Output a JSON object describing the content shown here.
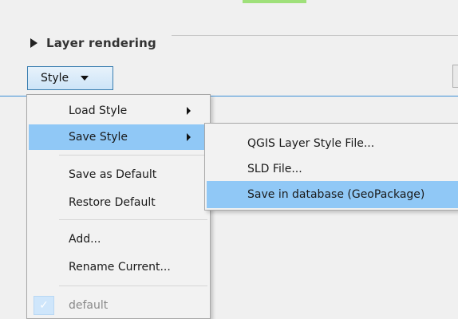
{
  "group": {
    "title": "Layer rendering"
  },
  "style_button": {
    "label": "Style"
  },
  "menu": {
    "items": [
      {
        "label": "Load Style"
      },
      {
        "label": "Save Style"
      },
      {
        "label": "Save as Default"
      },
      {
        "label": "Restore Default"
      },
      {
        "label": "Add..."
      },
      {
        "label": "Rename Current..."
      },
      {
        "label": "default"
      }
    ]
  },
  "submenu": {
    "items": [
      {
        "label": "QGIS Layer Style File..."
      },
      {
        "label": "SLD File..."
      },
      {
        "label": "Save in database (GeoPackage)"
      }
    ]
  },
  "colors": {
    "highlight": "#90c8f6",
    "button_border": "#3c7fb1",
    "tab_green": "#9fe07a",
    "rule_blue": "#3d8fd6"
  }
}
